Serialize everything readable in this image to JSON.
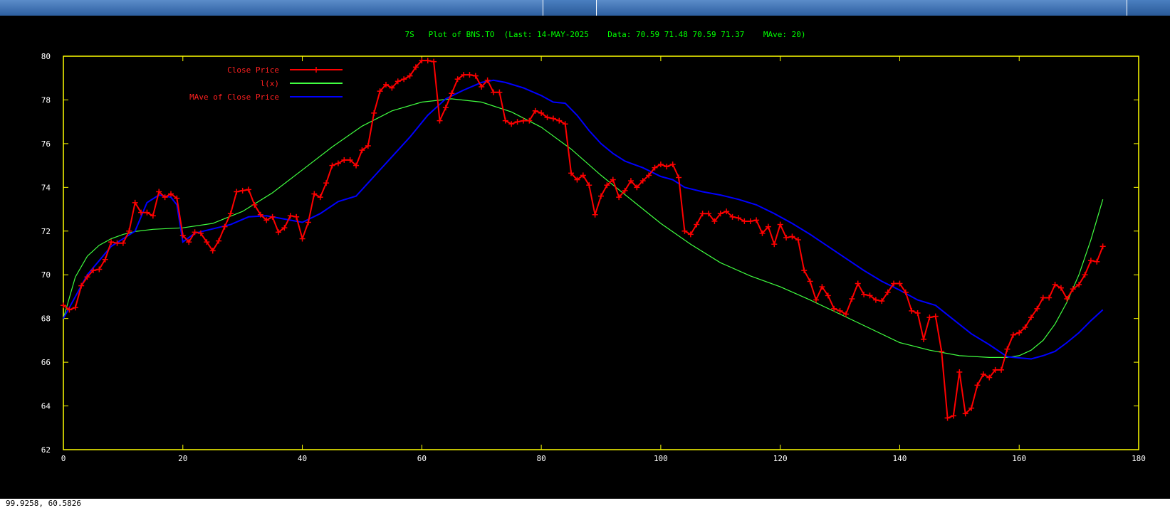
{
  "window": {
    "status_readout": "99.9258,  60.5826"
  },
  "chart_data": {
    "type": "line",
    "title": "7S   Plot of BNS.TO  (Last: 14-MAY-2025    Data: 70.59 71.48 70.59 71.37    MAve: 20)",
    "xlabel": "",
    "ylabel": "",
    "xlim": [
      0,
      180
    ],
    "ylim": [
      62,
      80
    ],
    "x_ticks": [
      0,
      20,
      40,
      60,
      80,
      100,
      120,
      140,
      160,
      180
    ],
    "y_ticks": [
      62,
      64,
      66,
      68,
      70,
      72,
      74,
      76,
      78,
      80
    ],
    "grid": false,
    "legend_position": "top-left",
    "colors": {
      "axes": "#ffff00",
      "title": "#00ff00",
      "legend_text": "#ff2020",
      "tick_text": "#ffffff",
      "close": "#ff0000",
      "fit": "#40ff40",
      "mave": "#0000ff"
    },
    "series": [
      {
        "name": "Close Price",
        "style": "line+marker",
        "color": "#ff0000",
        "x": [
          0,
          1,
          2,
          3,
          4,
          5,
          6,
          7,
          8,
          9,
          10,
          11,
          12,
          13,
          14,
          15,
          16,
          17,
          18,
          19,
          20,
          21,
          22,
          23,
          24,
          25,
          26,
          27,
          28,
          29,
          30,
          31,
          32,
          33,
          34,
          35,
          36,
          37,
          38,
          39,
          40,
          41,
          42,
          43,
          44,
          45,
          46,
          47,
          48,
          49,
          50,
          51,
          52,
          53,
          54,
          55,
          56,
          57,
          58,
          59,
          60,
          61,
          62,
          63,
          64,
          65,
          66,
          67,
          68,
          69,
          70,
          71,
          72,
          73,
          74,
          75,
          76,
          77,
          78,
          79,
          80,
          81,
          82,
          83,
          84,
          85,
          86,
          87,
          88,
          89,
          90,
          91,
          92,
          93,
          94,
          95,
          96,
          97,
          98,
          99,
          100,
          101,
          102,
          103,
          104,
          105,
          106,
          107,
          108,
          109,
          110,
          111,
          112,
          113,
          114,
          115,
          116,
          117,
          118,
          119,
          120,
          121,
          122,
          123,
          124,
          125,
          126,
          127,
          128,
          129,
          130,
          131,
          132,
          133,
          134,
          135,
          136,
          137,
          138,
          139,
          140,
          141,
          142,
          143,
          144,
          145,
          146,
          147,
          148,
          149,
          150,
          151,
          152,
          153,
          154,
          155,
          156,
          157,
          158,
          159,
          160,
          161,
          162,
          163,
          164,
          165,
          166,
          167,
          168,
          169,
          170,
          171,
          172,
          173,
          174
        ],
        "values": [
          68.6,
          68.4,
          68.5,
          69.5,
          69.9,
          70.2,
          70.25,
          70.7,
          71.5,
          71.45,
          71.45,
          72.0,
          73.3,
          72.85,
          72.85,
          72.7,
          73.8,
          73.55,
          73.7,
          73.5,
          71.8,
          71.5,
          71.95,
          71.9,
          71.5,
          71.1,
          71.55,
          72.2,
          72.8,
          73.8,
          73.85,
          73.9,
          73.2,
          72.75,
          72.5,
          72.65,
          71.95,
          72.15,
          72.7,
          72.65,
          71.65,
          72.4,
          73.7,
          73.55,
          74.2,
          75.0,
          75.1,
          75.25,
          75.25,
          75.0,
          75.7,
          75.9,
          77.4,
          78.4,
          78.7,
          78.55,
          78.85,
          78.95,
          79.1,
          79.5,
          79.8,
          79.8,
          79.75,
          77.05,
          77.65,
          78.3,
          78.95,
          79.15,
          79.15,
          79.1,
          78.6,
          78.9,
          78.35,
          78.35,
          77.05,
          76.9,
          77.0,
          77.05,
          77.05,
          77.5,
          77.4,
          77.2,
          77.15,
          77.05,
          76.9,
          74.65,
          74.35,
          74.55,
          74.1,
          72.75,
          73.6,
          74.1,
          74.35,
          73.55,
          73.85,
          74.3,
          74.0,
          74.3,
          74.55,
          74.9,
          75.05,
          74.95,
          75.05,
          74.45,
          72.0,
          71.85,
          72.3,
          72.8,
          72.8,
          72.45,
          72.8,
          72.9,
          72.65,
          72.6,
          72.45,
          72.45,
          72.5,
          71.9,
          72.2,
          71.4,
          72.3,
          71.7,
          71.75,
          71.6,
          70.2,
          69.7,
          68.85,
          69.45,
          69.05,
          68.45,
          68.35,
          68.2,
          68.9,
          69.6,
          69.1,
          69.05,
          68.85,
          68.8,
          69.2,
          69.6,
          69.6,
          69.2,
          68.35,
          68.25,
          67.05,
          68.05,
          68.1,
          66.5,
          63.45,
          63.55,
          65.55,
          63.65,
          63.9,
          64.95,
          65.45,
          65.3,
          65.65,
          65.65,
          66.6,
          67.25,
          67.35,
          67.6,
          68.05,
          68.45,
          68.95,
          68.95,
          69.55,
          69.4,
          68.9,
          69.35,
          69.55,
          70.0,
          70.65,
          70.6,
          71.3
        ]
      },
      {
        "name": "l(x)",
        "style": "line",
        "color": "#40ff40",
        "x": [
          0,
          2,
          4,
          6,
          8,
          10,
          12,
          15,
          20,
          25,
          30,
          35,
          40,
          45,
          50,
          55,
          60,
          65,
          70,
          75,
          80,
          85,
          90,
          95,
          100,
          105,
          110,
          115,
          120,
          125,
          130,
          135,
          140,
          145,
          150,
          155,
          158,
          160,
          162,
          164,
          166,
          168,
          170,
          172,
          174
        ],
        "values": [
          68.0,
          69.9,
          70.85,
          71.35,
          71.65,
          71.85,
          71.98,
          72.08,
          72.15,
          72.35,
          72.9,
          73.75,
          74.8,
          75.85,
          76.8,
          77.5,
          77.9,
          78.05,
          77.9,
          77.45,
          76.75,
          75.75,
          74.55,
          73.45,
          72.35,
          71.4,
          70.55,
          69.95,
          69.45,
          68.85,
          68.2,
          67.55,
          66.9,
          66.55,
          66.3,
          66.22,
          66.22,
          66.3,
          66.55,
          67.0,
          67.75,
          68.75,
          70.0,
          71.6,
          73.45
        ]
      },
      {
        "name": "MAve of Close Price",
        "style": "line",
        "color": "#0000ff",
        "x": [
          0,
          4,
          8,
          12,
          14,
          16,
          18,
          19,
          20,
          22,
          25,
          28,
          31,
          34,
          37,
          40,
          43,
          46,
          49,
          52,
          55,
          58,
          61,
          64,
          67,
          70,
          72,
          74,
          77,
          80,
          82,
          84,
          86,
          88,
          90,
          92,
          94,
          97,
          100,
          102,
          104,
          107,
          110,
          113,
          116,
          119,
          122,
          125,
          128,
          131,
          134,
          137,
          140,
          143,
          146,
          149,
          152,
          155,
          158,
          160,
          162,
          164,
          166,
          168,
          170,
          172,
          174
        ],
        "values": [
          68.0,
          70.0,
          71.3,
          72.0,
          73.3,
          73.65,
          73.55,
          73.2,
          71.5,
          71.9,
          72.1,
          72.3,
          72.65,
          72.7,
          72.55,
          72.4,
          72.8,
          73.35,
          73.6,
          74.5,
          75.4,
          76.3,
          77.3,
          78.05,
          78.45,
          78.8,
          78.9,
          78.8,
          78.55,
          78.2,
          77.9,
          77.85,
          77.3,
          76.6,
          76.0,
          75.55,
          75.2,
          74.9,
          74.5,
          74.35,
          74.0,
          73.8,
          73.65,
          73.45,
          73.2,
          72.8,
          72.35,
          71.85,
          71.3,
          70.75,
          70.2,
          69.7,
          69.3,
          68.85,
          68.6,
          67.95,
          67.3,
          66.8,
          66.25,
          66.2,
          66.15,
          66.3,
          66.5,
          66.9,
          67.35,
          67.9,
          68.4
        ]
      }
    ]
  }
}
